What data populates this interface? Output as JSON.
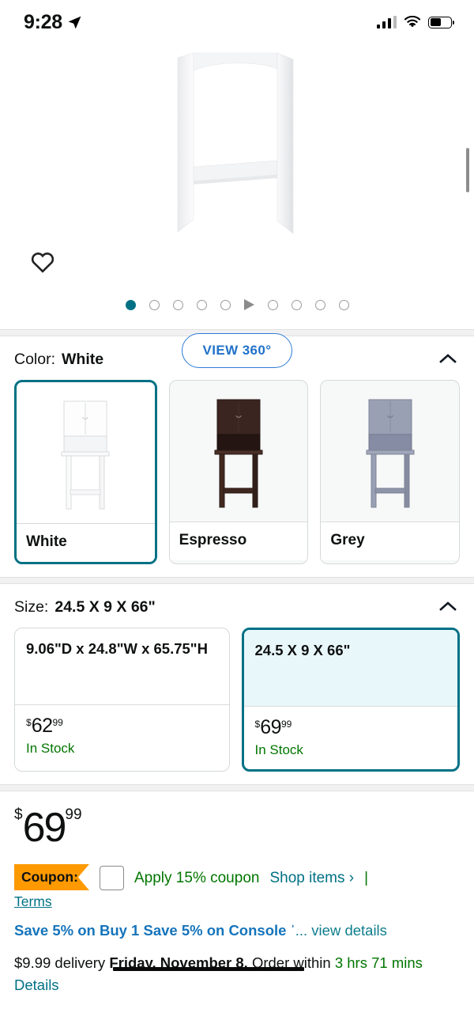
{
  "status_bar": {
    "time": "9:28",
    "location_icon": "location-arrow-icon",
    "signal_icon": "cellular-signal-icon",
    "wifi_icon": "wifi-icon",
    "battery_icon": "battery-icon"
  },
  "gallery": {
    "wishlist_icon": "heart-outline-icon",
    "product_image_alt": "white over-the-toilet storage frame",
    "dots": [
      {
        "type": "active"
      },
      {
        "type": "circle"
      },
      {
        "type": "circle"
      },
      {
        "type": "circle"
      },
      {
        "type": "circle"
      },
      {
        "type": "play"
      },
      {
        "type": "circle"
      },
      {
        "type": "circle"
      },
      {
        "type": "circle"
      },
      {
        "type": "circle"
      }
    ],
    "view360_label": "VIEW 360°"
  },
  "color_section": {
    "label": "Color:",
    "selected": "White",
    "collapse_icon": "chevron-up-icon",
    "options": [
      {
        "label": "White",
        "selected": true
      },
      {
        "label": "Espresso",
        "selected": false
      },
      {
        "label": "Grey",
        "selected": false
      }
    ]
  },
  "size_section": {
    "label": "Size:",
    "selected": "24.5 X 9 X 66\"",
    "collapse_icon": "chevron-up-icon",
    "options": [
      {
        "title": "9.06\"D x 24.8\"W x 65.75\"H",
        "currency": "$",
        "whole": "62",
        "fraction": "99",
        "stock": "In Stock",
        "selected": false
      },
      {
        "title": "24.5 X 9 X 66\"",
        "currency": "$",
        "whole": "69",
        "fraction": "99",
        "stock": "In Stock",
        "selected": true
      }
    ]
  },
  "price": {
    "currency": "$",
    "whole": "69",
    "fraction": "99"
  },
  "coupon": {
    "badge_label": "Coupon:",
    "terms_link": "Terms",
    "checkbox_checked": false,
    "apply_label": "Apply 15% coupon",
    "shop_items_link": "Shop items ›",
    "separator": "|"
  },
  "promotion": {
    "headline": "Save 5% on Buy 1 Save 5% on Console ˈ",
    "view_details": "... view details"
  },
  "delivery": {
    "cost_text": "$9.99 delivery ",
    "date": "Friday, November 8.",
    "order_within_text": " Order within ",
    "countdown": "3 hrs",
    "countdown_more": "71 mins",
    "details_link": "Details"
  },
  "colors": {
    "accent_teal": "#007185",
    "link_blue": "#2172c8",
    "success_green": "#007600",
    "coupon_orange": "#ff9900",
    "promo_blue": "#1574bb"
  }
}
